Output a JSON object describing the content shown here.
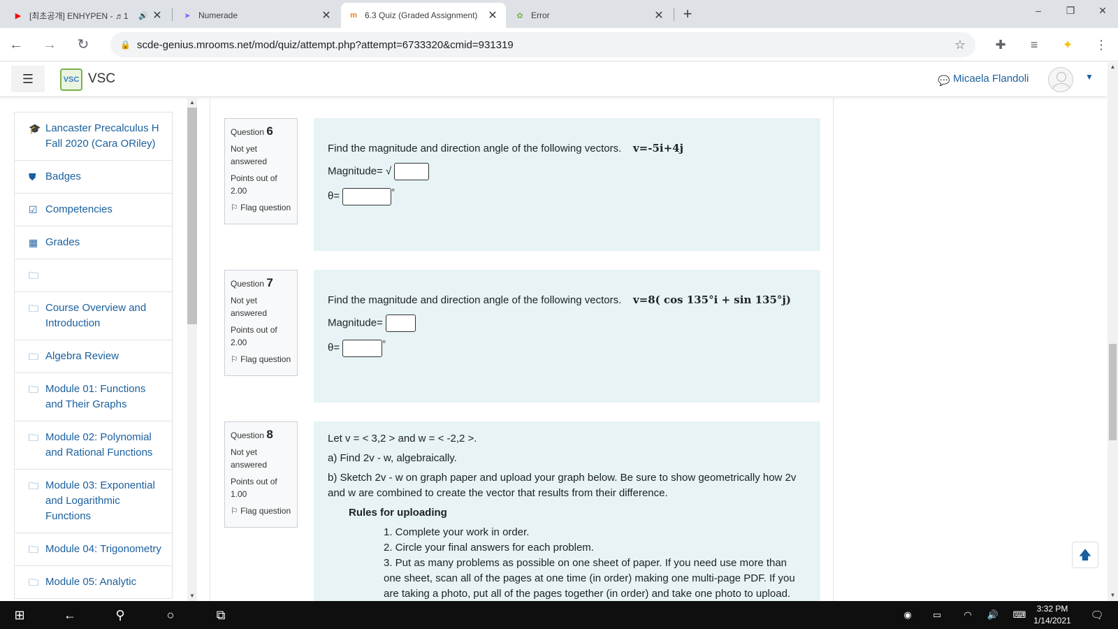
{
  "browser": {
    "tabs": [
      {
        "title": "[최초공개] ENHYPEN - ♬1",
        "favicon": "youtube-icon",
        "color": "#ff0000",
        "active": false
      },
      {
        "title": "Numerade",
        "favicon": "numerade-icon",
        "color": "#7b61ff",
        "active": false
      },
      {
        "title": "6.3 Quiz (Graded Assignment)",
        "favicon": "moodle-icon",
        "color": "#f98012",
        "active": true
      },
      {
        "title": "Error",
        "favicon": "vsc-icon",
        "color": "#79b34a",
        "active": false
      }
    ],
    "url": "scde-genius.mrooms.net/mod/quiz/attempt.php?attempt=6733320&cmid=931319"
  },
  "header": {
    "site_name": "VSC",
    "logo_text": "VSC",
    "user_name": "Micaela Flandoli"
  },
  "sidebar": {
    "items": [
      {
        "icon": "graduation-cap-icon",
        "glyph": "🎓",
        "label": "Lancaster Precalculus H Fall 2020 (Cara ORiley)"
      },
      {
        "icon": "shield-icon",
        "glyph": "⛊",
        "label": "Badges"
      },
      {
        "icon": "checkbox-icon",
        "glyph": "☑",
        "label": "Competencies"
      },
      {
        "icon": "table-icon",
        "glyph": "▦",
        "label": "Grades"
      },
      {
        "icon": "folder-icon",
        "glyph": "🗀",
        "label": ""
      },
      {
        "icon": "folder-icon",
        "glyph": "🗀",
        "label": "Course Overview and Introduction"
      },
      {
        "icon": "folder-icon",
        "glyph": "🗀",
        "label": "Algebra Review"
      },
      {
        "icon": "folder-icon",
        "glyph": "🗀",
        "label": "Module 01: Functions and Their Graphs"
      },
      {
        "icon": "folder-icon",
        "glyph": "🗀",
        "label": "Module 02: Polynomial and Rational Functions"
      },
      {
        "icon": "folder-icon",
        "glyph": "🗀",
        "label": "Module 03: Exponential and Logarithmic Functions"
      },
      {
        "icon": "folder-icon",
        "glyph": "🗀",
        "label": "Module 04: Trigonometry"
      },
      {
        "icon": "folder-icon",
        "glyph": "🗀",
        "label": "Module 05: Analytic"
      }
    ]
  },
  "questions": [
    {
      "prefix": "Question",
      "number": "6",
      "status": "Not yet answered",
      "points": "Points out of 2.00",
      "flag": "Flag question",
      "prompt": "Find the magnitude and direction angle of the following vectors.",
      "vector": "v=-5i+4j",
      "magnitude_label": "Magnitude= √",
      "theta_label": "θ=",
      "degree": "°"
    },
    {
      "prefix": "Question",
      "number": "7",
      "status": "Not yet answered",
      "points": "Points out of 2.00",
      "flag": "Flag question",
      "prompt": "Find the magnitude and direction angle of the following vectors.",
      "vector": "v=8( cos 135°i + sin 135°j)",
      "magnitude_label": "Magnitude=",
      "theta_label": "θ=",
      "degree": "°"
    },
    {
      "prefix": "Question",
      "number": "8",
      "status": "Not yet answered",
      "points": "Points out of 1.00",
      "flag": "Flag question",
      "line1": "Let v = < 3,2 > and w = < -2,2 >.",
      "line2": "a) Find 2v - w, algebraically.",
      "line3": "b) Sketch 2v - w on graph paper and upload your graph below. Be sure to show geometrically how 2v and w are combined to create the vector that results from their difference.",
      "rules_title": "Rules for uploading",
      "rules": [
        "1. Complete your work in order.",
        "2. Circle your final answers for each problem.",
        "3. Put as many problems as possible on one sheet of paper. If you need use more than one sheet, scan all of the pages at one time (in order) making one multi-page PDF. If you are taking a photo, put all of the pages together (in order) and take one photo to upload."
      ]
    }
  ],
  "taskbar": {
    "time": "3:32 PM",
    "date": "1/14/2021"
  }
}
